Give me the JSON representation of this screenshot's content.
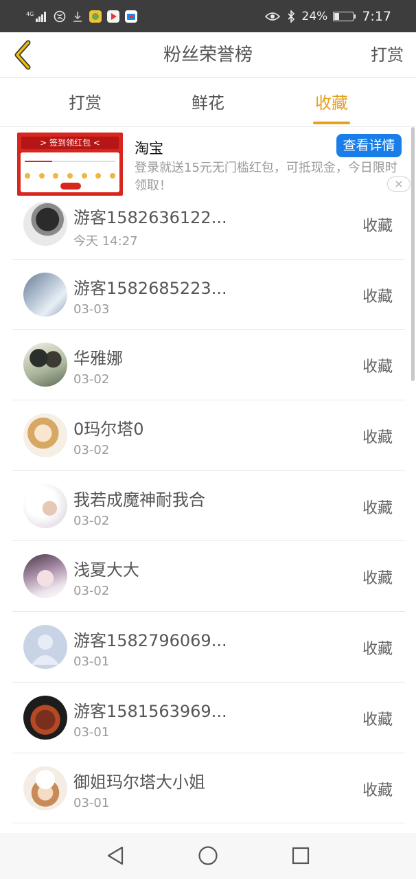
{
  "status_bar": {
    "network": "4G",
    "battery": "24%",
    "time": "7:17",
    "icons": [
      "signal-icon",
      "globe-icon",
      "download-icon",
      "app-icon",
      "video-icon",
      "store-icon",
      "eye-icon",
      "bluetooth-icon",
      "battery-icon"
    ]
  },
  "header": {
    "back_icon": "chevron-left-icon",
    "title": "粉丝荣誉榜",
    "right_action": "打赏"
  },
  "tabs": [
    {
      "label": "打赏",
      "active": false
    },
    {
      "label": "鲜花",
      "active": false
    },
    {
      "label": "收藏",
      "active": true
    }
  ],
  "colors": {
    "accent": "#e6a11f",
    "ad_button": "#1a7ee8",
    "status_bar": "#3d3d3d"
  },
  "ad": {
    "banner_text": "> 签到领红包 <",
    "brand": "淘宝",
    "cta": "查看详情",
    "description": "登录就送15元无门槛红包，可抵现金，今日限时领取！",
    "close_icon": "close-icon"
  },
  "list": [
    {
      "name": "游客1582636122...",
      "date": "今天 14:27",
      "action": "收藏"
    },
    {
      "name": "游客1582685223...",
      "date": "03-03",
      "action": "收藏"
    },
    {
      "name": "华雅娜",
      "date": "03-02",
      "action": "收藏"
    },
    {
      "name": "0玛尔塔0",
      "date": "03-02",
      "action": "收藏"
    },
    {
      "name": "我若成魔神耐我合",
      "date": "03-02",
      "action": "收藏"
    },
    {
      "name": "浅夏大大",
      "date": "03-02",
      "action": "收藏"
    },
    {
      "name": "游客1582796069...",
      "date": "03-01",
      "action": "收藏"
    },
    {
      "name": "游客1581563969...",
      "date": "03-01",
      "action": "收藏"
    },
    {
      "name": "御姐玛尔塔大小姐",
      "date": "03-01",
      "action": "收藏"
    }
  ],
  "nav": {
    "back": "nav-back-icon",
    "home": "nav-home-icon",
    "recents": "nav-recents-icon"
  }
}
